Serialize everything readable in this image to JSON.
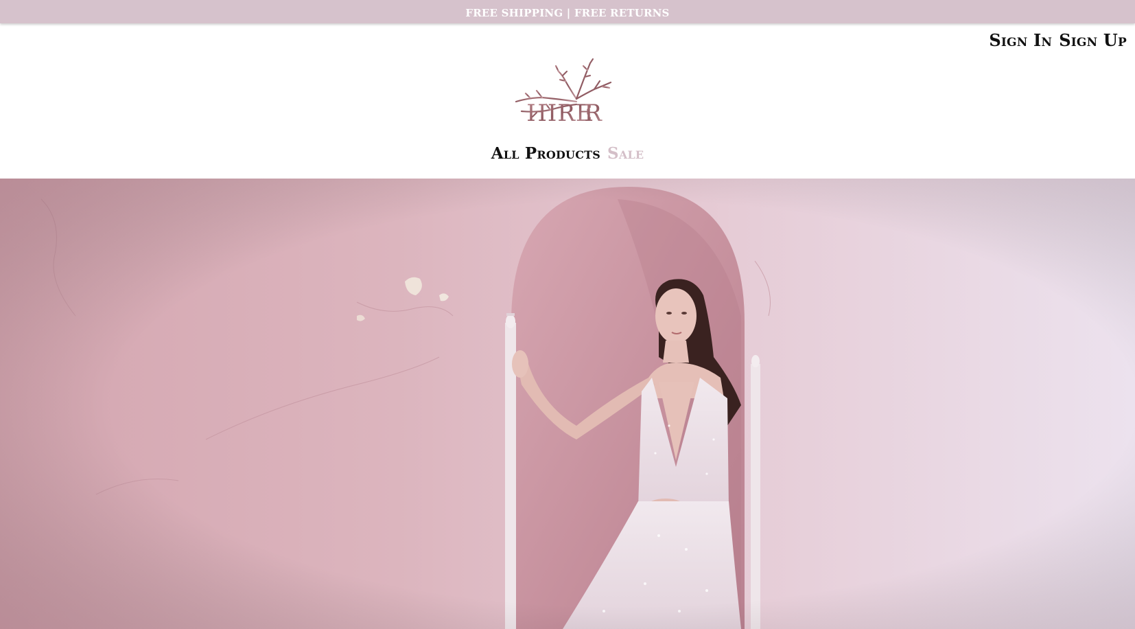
{
  "announcement": {
    "text": "FREE SHIPPING | FREE RETURNS"
  },
  "account": {
    "sign_in": "Sign In",
    "sign_up": "Sign Up"
  },
  "logo": {
    "text": "HIRE|R",
    "icon": "tree-logo-icon"
  },
  "nav": {
    "items": [
      {
        "label": "All Products"
      },
      {
        "label": "Sale"
      }
    ]
  },
  "hero": {
    "image": "bride-in-white-gown-standing-in-pink-arched-alcove"
  },
  "colors": {
    "announcement_bg": "#d6c2cc",
    "logo_rose": "#9e6a70",
    "sale_text": "#d4bfc8",
    "hero_wall": "#d9afb9"
  }
}
